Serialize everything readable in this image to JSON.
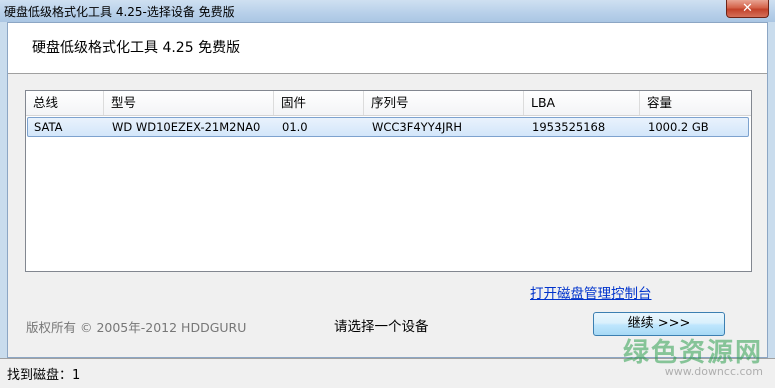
{
  "window": {
    "title": "硬盘低级格式化工具 4.25-选择设备   免费版",
    "close_label": "✕"
  },
  "header": {
    "app_title": "硬盘低级格式化工具 4.25   免费版"
  },
  "device_list": {
    "columns": [
      "总线",
      "型号",
      "固件",
      "序列号",
      "LBA",
      "容量"
    ],
    "rows": [
      {
        "bus": "SATA",
        "model": "WD WD10EZEX-21M2NA0",
        "firmware": "01.0",
        "serial": "WCC3F4YY4JRH",
        "lba": "1953525168",
        "capacity": "1000.2 GB"
      }
    ]
  },
  "disk_management_link": "打开磁盘管理控制台",
  "copyright": "版权所有 © 2005年-2012 HDDGURU",
  "prompt": "请选择一个设备",
  "continue_button": "继续 >>>",
  "status": "找到磁盘：1",
  "watermark": {
    "main": "绿色资源网",
    "sub": "www.downcc.com"
  }
}
